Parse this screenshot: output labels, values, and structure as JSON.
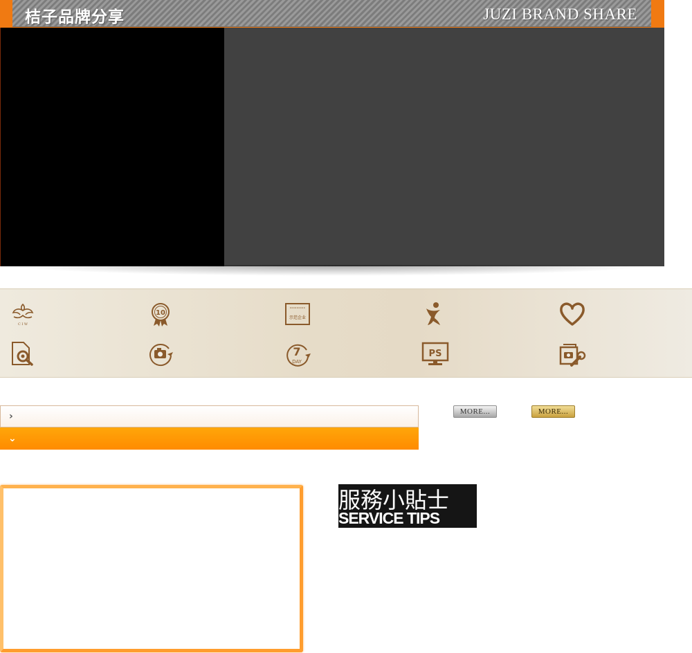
{
  "header": {
    "title_cn": "桔子品牌分享",
    "title_en": "JUZI BRAND SHARE"
  },
  "hero": {
    "left_color": "#000000",
    "right_color": "#414141"
  },
  "features": {
    "icons": [
      "ciw-logo-icon",
      "ten-year-medal-icon",
      "certificate-icon",
      "person-icon",
      "heart-icon",
      "document-search-icon",
      "camera-rotate-icon",
      "seven-day-icon",
      "ps-monitor-icon",
      "photo-edit-tool-icon"
    ],
    "ciw_text": "C I W",
    "medal_text": "10",
    "certificate_text": "示范企业",
    "seven_text": "7",
    "day_text": "DAY",
    "ps_text": "PS"
  },
  "accordion": {
    "rows": [
      {
        "label": "",
        "state": "collapsed"
      },
      {
        "label": "",
        "state": "expanded"
      }
    ]
  },
  "more_buttons": {
    "grey_label": "MORE...",
    "gold_label": "MORE..."
  },
  "tips": {
    "title_cn": "服務小貼士",
    "title_en": "SERVICE TIPS"
  },
  "colors": {
    "accent_orange": "#f07a12",
    "accordion_active": "#ff8b00",
    "frame_orange": "#ff9d2e"
  }
}
